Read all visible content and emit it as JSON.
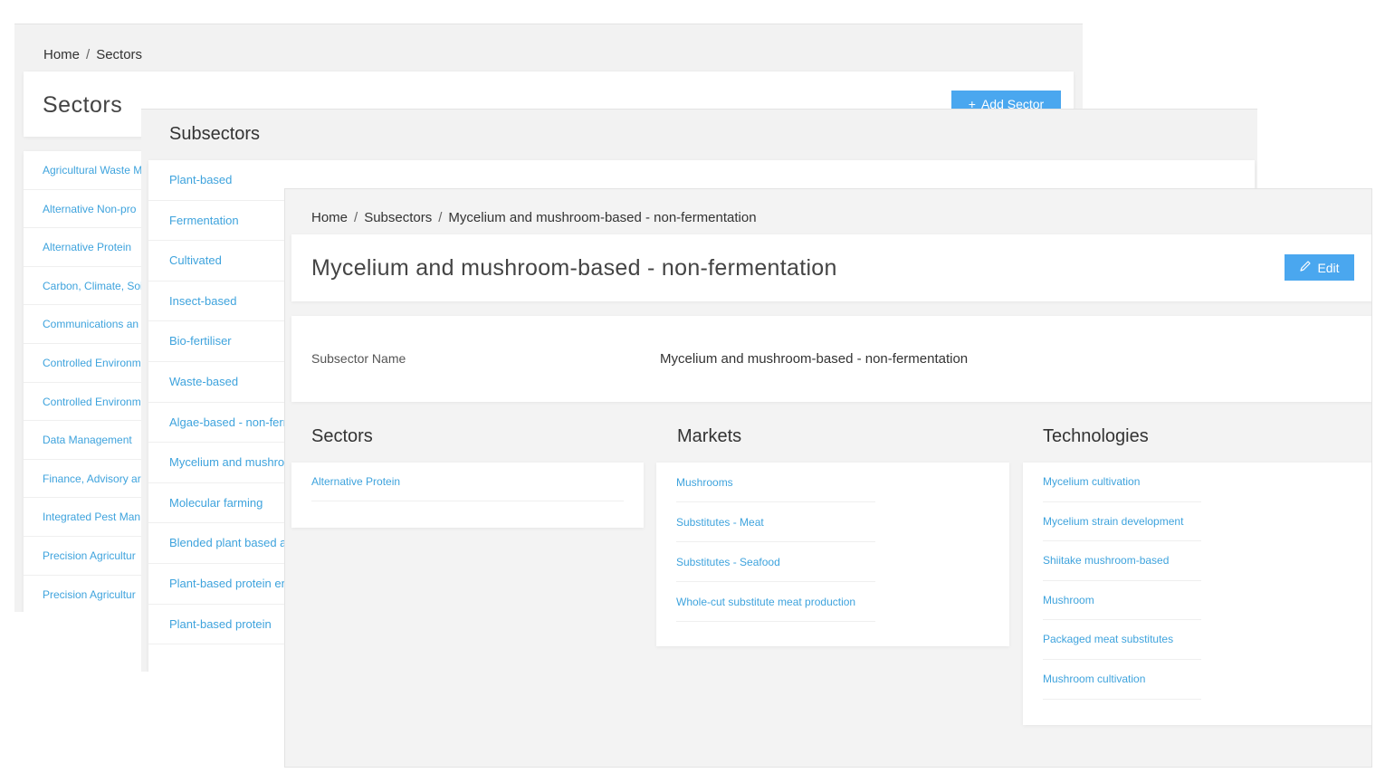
{
  "sectors_window": {
    "breadcrumb": {
      "home": "Home",
      "separator": "/",
      "current": "Sectors"
    },
    "title": "Sectors",
    "add_button": {
      "icon": "plus-icon",
      "icon_glyph": "+",
      "label": "Add Sector"
    },
    "items": [
      "Agricultural Waste M",
      "Alternative Non-pro",
      "Alternative Protein",
      "Carbon, Climate, Soi",
      "Communications an",
      "Controlled Environm",
      "Controlled Environm",
      "Data Management",
      "Finance, Advisory ar",
      "Integrated Pest Man",
      "Precision Agricultur",
      "Precision Agricultur"
    ]
  },
  "subsectors_window": {
    "title": "Subsectors",
    "items": [
      "Plant-based",
      "Fermentation",
      "Cultivated",
      "Insect-based",
      "Bio-fertiliser",
      "Waste-based",
      "Algae-based - non-ferm",
      "Mycelium and mushro",
      "Molecular farming",
      "Blended plant based an",
      "Plant-based protein en",
      "Plant-based protein"
    ]
  },
  "detail_window": {
    "breadcrumb": {
      "home": "Home",
      "separator": "/",
      "parent": "Subsectors",
      "current": "Mycelium and mushroom-based - non-fermentation"
    },
    "title": "Mycelium and mushroom-based - non-fermentation",
    "edit_button": {
      "icon": "pencil-icon",
      "label": "Edit"
    },
    "field": {
      "label": "Subsector Name",
      "value": "Mycelium and mushroom-based - non-fermentation"
    },
    "sectors": {
      "heading": "Sectors",
      "items": [
        "Alternative Protein"
      ]
    },
    "markets": {
      "heading": "Markets",
      "items": [
        "Mushrooms",
        "Substitutes - Meat",
        "Substitutes - Seafood",
        "Whole-cut substitute meat production"
      ]
    },
    "technologies": {
      "heading": "Technologies",
      "items": [
        "Mycelium cultivation",
        "Mycelium strain development",
        "Shiitake mushroom-based",
        "Mushroom",
        "Packaged meat substitutes",
        "Mushroom cultivation"
      ]
    }
  },
  "colors": {
    "link": "#3ea3dd",
    "button": "#4aa7ef",
    "background": "#f2f2f2"
  }
}
